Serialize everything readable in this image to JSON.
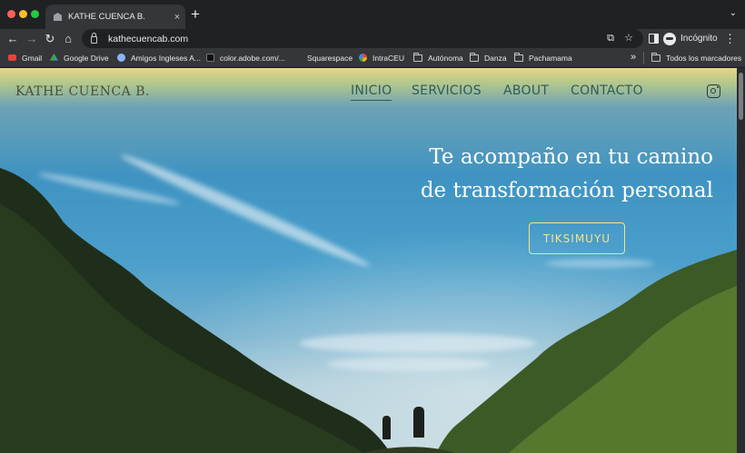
{
  "browser": {
    "tab_title": "KATHE CUENCA B.",
    "url": "kathecuencab.com",
    "profile_label": "Incógnito",
    "icons": {
      "new_tab": "plus-icon",
      "tab_close": "close-icon",
      "back": "arrow-left-icon",
      "forward": "arrow-right-icon",
      "reload": "reload-icon",
      "home": "home-icon"
    },
    "glyphs": {
      "new_tab": "+",
      "tab_close": "×",
      "back": "←",
      "forward": "→",
      "reload": "↻",
      "home": "⌂",
      "camera": "⧉",
      "star": "☆",
      "more": "⋮",
      "tab_menu": "⌄",
      "bookmarks_more": "»"
    }
  },
  "bookmarks": [
    {
      "label": "Gmail",
      "icon": "gmail-icon",
      "color": "#ea4335"
    },
    {
      "label": "Google Drive",
      "icon": "google-drive-icon",
      "color": "#fbbc04"
    },
    {
      "label": "Amigos Ingleses A...",
      "icon": "globe-icon",
      "color": "#8ab4f8"
    },
    {
      "label": "color.adobe.com/...",
      "icon": "adobe-color-icon",
      "color": "#1f1f1f"
    },
    {
      "label": "Squarespace",
      "icon": "squarespace-icon",
      "color": "#35363a"
    },
    {
      "label": "IntraCEU",
      "icon": "intraceu-icon",
      "color": "#34a853"
    },
    {
      "label": "Autónoma",
      "icon": "folder-icon"
    },
    {
      "label": "Danza",
      "icon": "folder-icon"
    },
    {
      "label": "Pachamama",
      "icon": "folder-icon"
    }
  ],
  "all_bookmarks_label": "Todos los marcadores",
  "site": {
    "logo": "KATHE CUENCA B.",
    "nav": [
      {
        "label": "INICIO",
        "active": true
      },
      {
        "label": "SERVICIOS",
        "active": false
      },
      {
        "label": "ABOUT",
        "active": false
      },
      {
        "label": "CONTACTO",
        "active": false
      }
    ],
    "headline_line1": "Te acompaño en tu camino",
    "headline_line2": "de transformación personal",
    "cta_label": "TIKSIMUYU",
    "colors": {
      "nav_text": "#2f5a5c",
      "cta_border": "#f3e48d",
      "logo": "#4a4f3a"
    }
  }
}
